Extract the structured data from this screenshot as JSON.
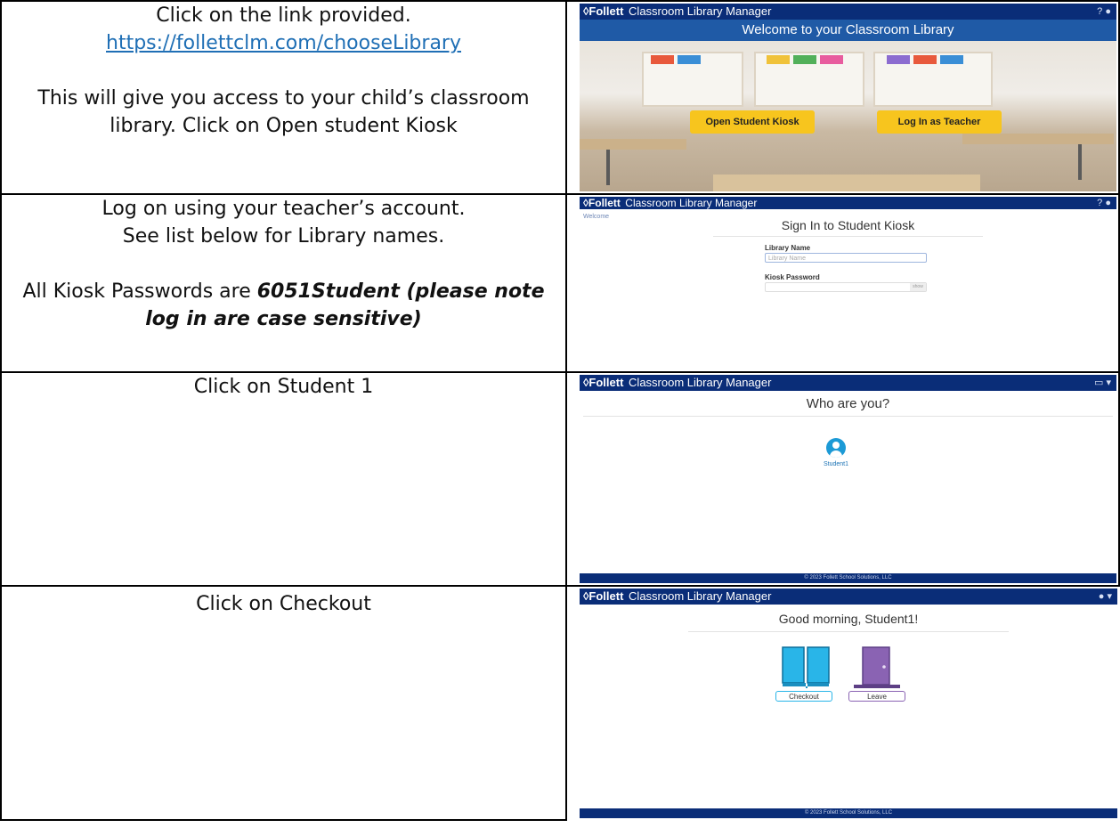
{
  "steps": [
    {
      "instruction_line1": "Click on the link provided.",
      "link": "https://follettclm.com/chooseLibrary",
      "instruction_line2": "This will give you access to your child’s classroom library. Click on Open student Kiosk"
    },
    {
      "instruction_line1": "Log on using your teacher’s account.",
      "instruction_line2": "See list below for Library names.",
      "instruction_line3_prefix": "All Kiosk Passwords are ",
      "instruction_line3_emphasis": "6051Student (please note log in are case sensitive)"
    },
    {
      "instruction_line1": "Click on Student 1"
    },
    {
      "instruction_line1": "Click on Checkout"
    }
  ],
  "app": {
    "logo_mark": "◊Follett",
    "app_name": "Classroom Library Manager",
    "footer": "© 2023 Follett School Solutions, LLC"
  },
  "panel1": {
    "banner": "Welcome to your Classroom Library",
    "open_kiosk": "Open Student Kiosk",
    "log_in_teacher": "Log In as Teacher"
  },
  "panel2": {
    "breadcrumb": "Welcome",
    "title": "Sign In to Student Kiosk",
    "library_label": "Library Name",
    "library_placeholder": "Library Name",
    "password_label": "Kiosk Password",
    "show_toggle": "show"
  },
  "panel3": {
    "title": "Who are you?",
    "student": "Student1"
  },
  "panel4": {
    "title": "Good morning, Student1!",
    "checkout": "Checkout",
    "leave": "Leave"
  },
  "colors": {
    "header": "#0a2d78",
    "banner": "#1f5aa6",
    "kiosk_button": "#f7c51e",
    "book_icon": "#29b5e8",
    "door_icon": "#8a63b3"
  }
}
